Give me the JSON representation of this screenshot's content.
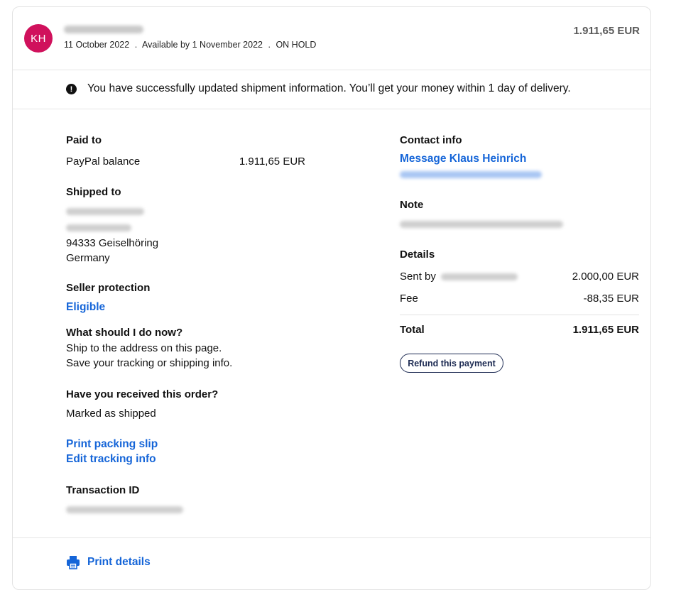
{
  "header": {
    "avatar_initials": "KH",
    "date": "11 October 2022",
    "available": "Available by 1 November 2022",
    "status": "ON HOLD",
    "separator": ".",
    "amount": "1.911,65 EUR"
  },
  "notice": {
    "icon": "alert-circle-icon",
    "text": "You have successfully updated shipment information. You’ll get your money within 1 day of delivery."
  },
  "left": {
    "paid_to": {
      "label": "Paid to",
      "method": "PayPal balance",
      "amount": "1.911,65 EUR"
    },
    "shipped_to": {
      "label": "Shipped to",
      "city": "94333 Geiselhöring",
      "country": "Germany"
    },
    "seller_protection": {
      "label": "Seller protection",
      "value": "Eligible"
    },
    "what_now": {
      "label": "What should I do now?",
      "line1": "Ship to the address on this page.",
      "line2": "Save your tracking or shipping info."
    },
    "received": {
      "label": "Have you received this order?",
      "value": "Marked as shipped"
    },
    "links": {
      "print_packing_slip": "Print packing slip",
      "edit_tracking": "Edit tracking info"
    },
    "transaction": {
      "label": "Transaction ID"
    }
  },
  "right": {
    "contact": {
      "label": "Contact info",
      "message_link": "Message Klaus Heinrich"
    },
    "note": {
      "label": "Note"
    },
    "details": {
      "label": "Details",
      "sent_by_label": "Sent by",
      "sent_amount": "2.000,00 EUR",
      "fee_label": "Fee",
      "fee_amount": "-88,35 EUR",
      "total_label": "Total",
      "total_amount": "1.911,65 EUR"
    },
    "refund_button": "Refund this payment"
  },
  "footer": {
    "print_details": "Print details",
    "icon": "printer-icon"
  },
  "colors": {
    "avatar": "#d0115c",
    "link": "#1565d8",
    "button_border": "#1c2a52"
  }
}
